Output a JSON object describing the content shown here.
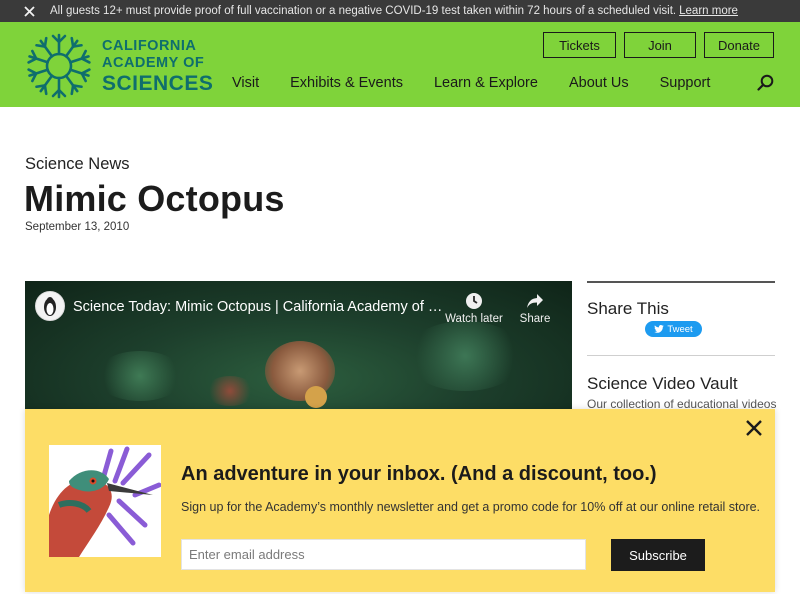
{
  "alert": {
    "text": "All guests 12+ must provide proof of full vaccination or a negative COVID-19 test taken within 72 hours of a scheduled visit.",
    "link_label": "Learn more",
    "close_icon": "close-icon"
  },
  "brand": {
    "line1": "CALIFORNIA",
    "line2": "ACADEMY OF",
    "line3": "SCIENCES",
    "logo_icon": "snowflake-sunburst-logo",
    "color": "#0f6e6d"
  },
  "header": {
    "background": "#7fd33a",
    "buttons": {
      "tickets": "Tickets",
      "join": "Join",
      "donate": "Donate"
    },
    "nav": [
      "Visit",
      "Exhibits & Events",
      "Learn & Explore",
      "About Us",
      "Support"
    ],
    "search_icon": "search-icon"
  },
  "article": {
    "category": "Science News",
    "title": "Mimic Octopus",
    "date": "September 13, 2010"
  },
  "video": {
    "title": "Science Today: Mimic Octopus | California Academy of S...",
    "watch_later_label": "Watch later",
    "share_label": "Share",
    "watch_later_icon": "clock-icon",
    "share_icon": "share-arrow-icon",
    "channel_icon": "penguin-avatar-icon"
  },
  "sidebar": {
    "share_title": "Share This",
    "tweet_label": "Tweet",
    "vault_title": "Science Video Vault",
    "vault_subtitle": "Our collection of educational videos"
  },
  "newsletter": {
    "heading": "An adventure in your inbox. (And a discount, too.)",
    "subtext": "Sign up for the Academy’s monthly newsletter and get a promo code for 10% off at our online retail store.",
    "email_placeholder": "Enter email address",
    "subscribe_label": "Subscribe",
    "background": "#fddd66",
    "close_icon": "close-icon",
    "image_icon": "bird-illustration"
  }
}
